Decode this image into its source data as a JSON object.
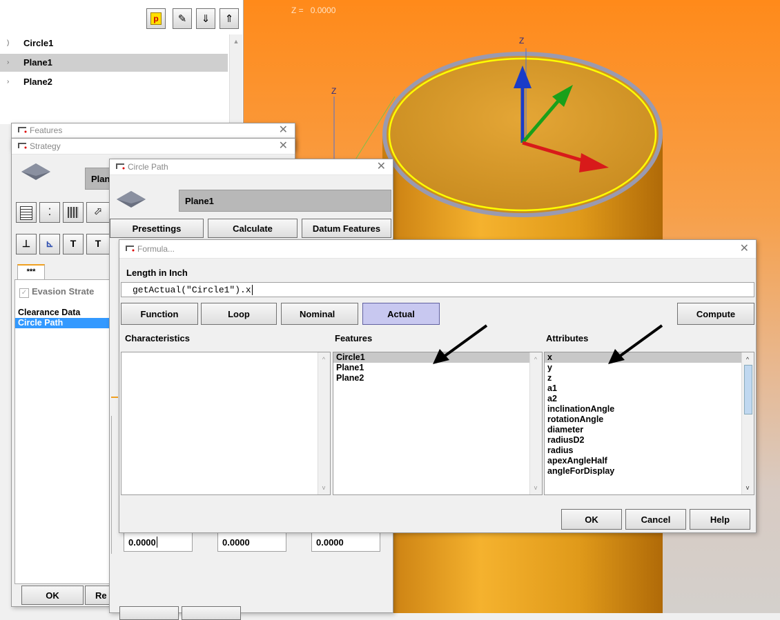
{
  "viewport": {
    "z_readout_label": "Z =",
    "z_readout_value": "0.0000",
    "axis_z_label": "Z",
    "axis_z2_label": "Z"
  },
  "tree": {
    "toolbar": [
      {
        "name": "p-toolbar-button",
        "glyph": "p"
      },
      {
        "name": "pencil-toolbar-button",
        "glyph": "✎"
      },
      {
        "name": "move-down-toolbar-button",
        "glyph": "⇓"
      },
      {
        "name": "move-up-toolbar-button",
        "glyph": "⇑"
      }
    ],
    "items": [
      {
        "label": "Circle1",
        "selected": false
      },
      {
        "label": "Plane1",
        "selected": true
      },
      {
        "label": "Plane2",
        "selected": false
      }
    ]
  },
  "features_window": {
    "title": "Features"
  },
  "strategy_window": {
    "title": "Strategy",
    "feature_field": "Plan",
    "tab_label": "***",
    "evasion_checkbox": "Evasion Strate",
    "list": [
      "Clearance Data",
      "Circle Path"
    ],
    "ok_label": "OK",
    "r_label": "Re"
  },
  "circle_path_window": {
    "title": "Circle Path",
    "feature_field": "Plane1",
    "presettings_label": "Presettings",
    "calculate_label": "Calculate",
    "datum_features_label": "Datum Features",
    "fields": [
      "0.0000",
      "0.0000",
      "0.0000"
    ]
  },
  "formula_window": {
    "title": "Formula...",
    "length_label": "Length in Inch",
    "formula_value": "getActual(\"Circle1\").x",
    "function_label": "Function",
    "loop_label": "Loop",
    "nominal_label": "Nominal",
    "actual_label": "Actual",
    "compute_label": "Compute",
    "characteristics_header": "Characteristics",
    "features_header": "Features",
    "attributes_header": "Attributes",
    "features": [
      "Circle1",
      "Plane1",
      "Plane2"
    ],
    "attributes": [
      "x",
      "y",
      "z",
      "a1",
      "a2",
      "inclinationAngle",
      "rotationAngle",
      "diameter",
      "radiusD2",
      "radius",
      "apexAngleHalf",
      "angleForDisplay"
    ],
    "ok_label": "OK",
    "cancel_label": "Cancel",
    "help_label": "Help"
  },
  "colors": {
    "viewport_top": "#ff8a1a",
    "cylinder": "#e9a21c",
    "rim": "#ffff00",
    "actual_active": "#c8c8f0"
  }
}
